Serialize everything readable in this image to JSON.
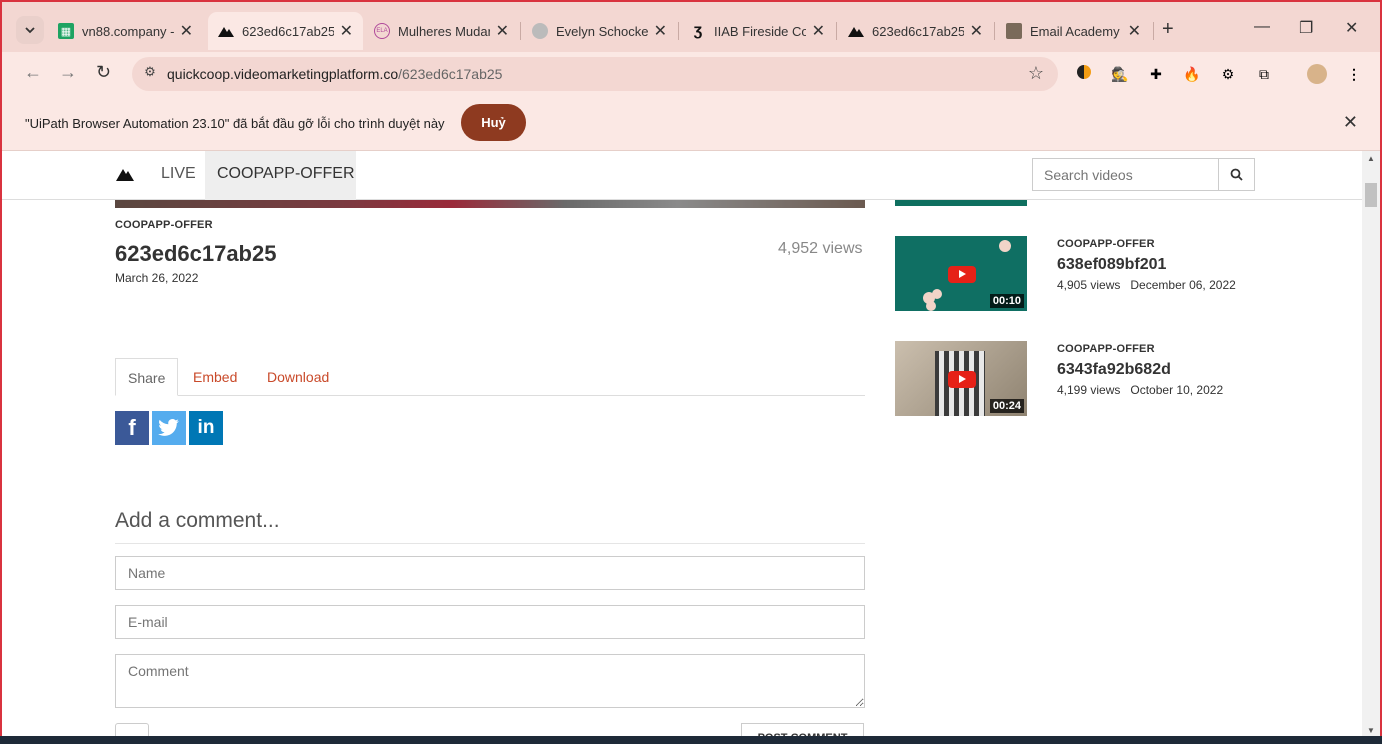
{
  "tabs": [
    {
      "title": "vn88.company - ",
      "active": false
    },
    {
      "title": "623ed6c17ab25",
      "active": true
    },
    {
      "title": "Mulheres Mudar",
      "active": false
    },
    {
      "title": "Evelyn Schocken",
      "active": false
    },
    {
      "title": "IIAB Fireside Cor",
      "active": false
    },
    {
      "title": "623ed6c17ab25",
      "active": false
    },
    {
      "title": "Email Academy",
      "active": false
    }
  ],
  "omnibox": {
    "host": "quickcoop.videomarketingplatform.co",
    "path": "/623ed6c17ab25"
  },
  "infobar": {
    "message": "\"UiPath Browser Automation 23.10\" đã bắt đầu gỡ lỗi cho trình duyệt này",
    "button": "Huỷ"
  },
  "site_nav": {
    "live": "LIVE",
    "channel": "COOPAPP-OFFER",
    "search_placeholder": "Search videos"
  },
  "video": {
    "category": "COOPAPP-OFFER",
    "title": "623ed6c17ab25",
    "date": "March 26, 2022",
    "views": "4,952 views"
  },
  "share_tabs": {
    "share": "Share",
    "embed": "Embed",
    "download": "Download"
  },
  "comment": {
    "heading": "Add a comment...",
    "name_placeholder": "Name",
    "email_placeholder": "E-mail",
    "comment_placeholder": "Comment",
    "post_button": "POST COMMENT"
  },
  "related": [
    {
      "category": "COOPAPP-OFFER",
      "title": "638ef089bf201",
      "views": "4,905 views",
      "date": "December 06, 2022",
      "duration": "00:10"
    },
    {
      "category": "COOPAPP-OFFER",
      "title": "6343fa92b682d",
      "views": "4,199 views",
      "date": "October 10, 2022",
      "duration": "00:24"
    }
  ],
  "colors": {
    "accent_link": "#c94a2a",
    "infobar_button": "#8e3a20",
    "frame_border": "#d9333f"
  }
}
